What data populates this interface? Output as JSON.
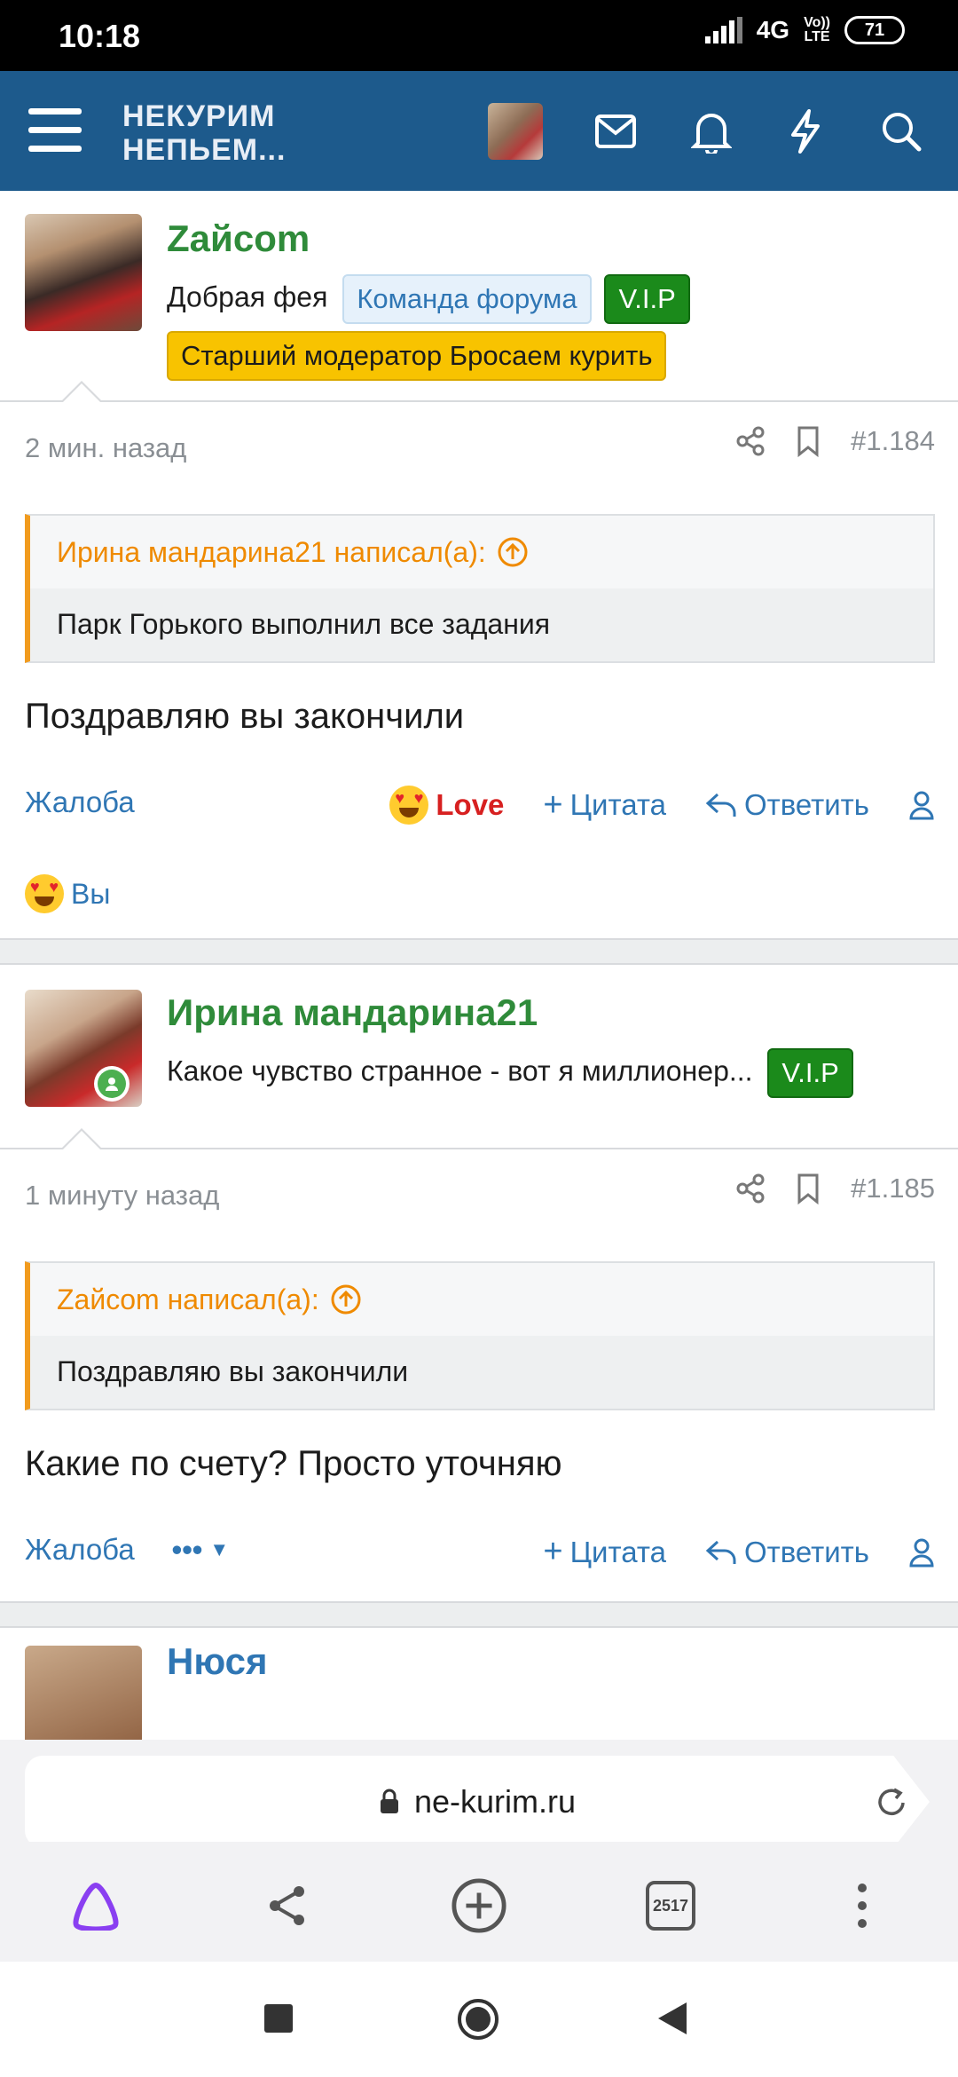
{
  "status_bar": {
    "time": "10:18",
    "network": "4G",
    "volte_top": "Vo))",
    "volte_bottom": "LTE",
    "battery": "71"
  },
  "header": {
    "logo_line1": "НЕКУРИМ",
    "logo_line2": "НЕПЬЕМ..."
  },
  "posts": [
    {
      "username": "Zайcom",
      "user_title": "Добрая фея",
      "badges": {
        "team": "Команда форума",
        "vip": "V.I.P",
        "moderator": "Старший модератор Бросаем курить"
      },
      "time": "2 мин. назад",
      "number": "#1.184",
      "quote_author": "Ирина мандарина21 написал(а):",
      "quote_text": "Парк Горького выполнил все задания",
      "message": "Поздравляю вы закончили",
      "report": "Жалоба",
      "reaction_label": "Love",
      "quote_button": "Цитата",
      "reply_button": "Ответить",
      "reacted_by": "Вы"
    },
    {
      "username": "Ирина мандарина21",
      "user_title": "Какое чувство странное - вот я миллионер...",
      "badges": {
        "vip": "V.I.P"
      },
      "time": "1 минуту назад",
      "number": "#1.185",
      "quote_author": "Zайcom написал(а):",
      "quote_text": "Поздравляю вы закончили",
      "message": "Какие по счету? Просто уточняю",
      "report": "Жалоба",
      "more": "•••",
      "quote_button": "Цитата",
      "reply_button": "Ответить"
    },
    {
      "username_partial": "Нюся"
    }
  ],
  "browser": {
    "url": "ne-kurim.ru",
    "tab_count": "2517"
  },
  "colors": {
    "header_bg": "#1d5a8c",
    "username_green": "#2f8b3a",
    "link_blue": "#2f76b4",
    "quote_orange": "#f19b1e",
    "vip_green": "#1b8a1b",
    "mod_yellow": "#f8c300"
  }
}
